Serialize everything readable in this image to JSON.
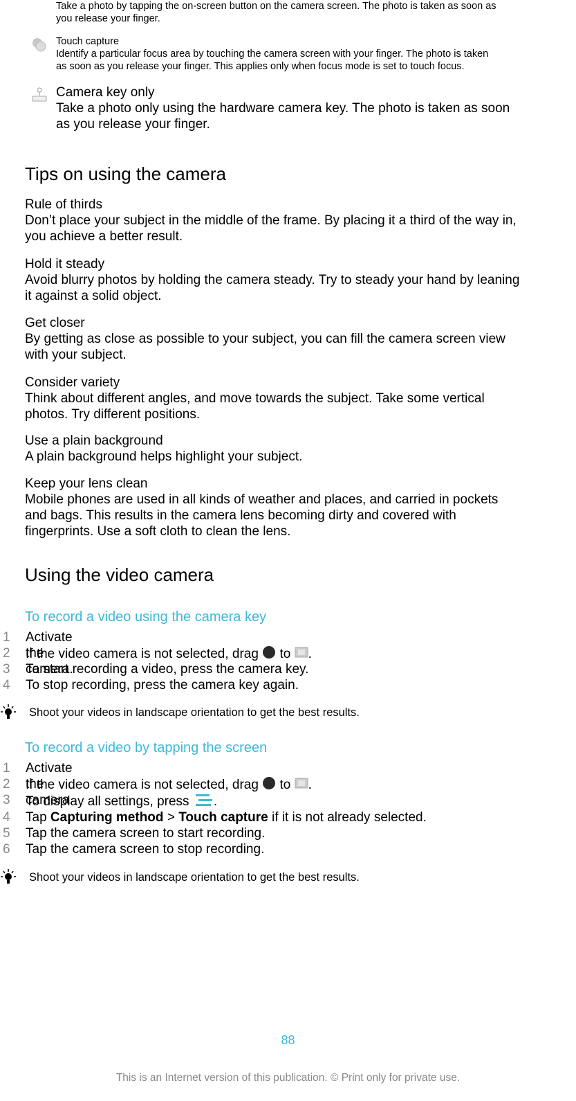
{
  "capture_methods": {
    "onscreen_desc_line1": "Take a photo by tapping the on-screen button on the camera screen. The photo is taken as soon as",
    "onscreen_desc_line2": "you release your finger.",
    "touch_title": "Touch capture",
    "touch_desc_line1": "Identify a particular focus area by touching the camera screen with your finger. The photo is taken",
    "touch_desc_line2": "as soon as you release your finger. This applies only when focus mode is set to touch focus.",
    "key_title": "Camera key only",
    "key_desc_line1": "Take a photo only using the hardware camera key. The photo is taken as soon",
    "key_desc_line2": "as you release your finger."
  },
  "tips": {
    "heading": "Tips on using the camera",
    "items": [
      {
        "title": "Rule of thirds",
        "line1": "Don’t place your subject in the middle of the frame. By placing it a third of the way in,",
        "line2": "you achieve a better result."
      },
      {
        "title": "Hold it steady",
        "line1": "Avoid blurry photos by holding the camera steady. Try to steady your hand by leaning",
        "line2": "it against a solid object."
      },
      {
        "title": "Get closer",
        "line1": "By getting as close as possible to your subject, you can fill the camera screen view",
        "line2": "with your subject."
      },
      {
        "title": "Consider variety",
        "line1": "Think about different angles, and move towards the subject. Take some vertical",
        "line2": "photos. Try different positions."
      },
      {
        "title": "Use a plain background",
        "line1": "A plain background helps highlight your subject."
      },
      {
        "title": "Keep your lens clean",
        "line1": "Mobile phones are used in all kinds of weather and places, and carried in pockets",
        "line2": "and bags. This results in the camera lens becoming dirty and covered with",
        "line3": "fingerprints. Use a soft cloth to clean the lens."
      }
    ]
  },
  "video": {
    "heading": "Using the video camera",
    "proc1": {
      "title": "To record a video using the camera key",
      "steps": [
        {
          "n": "1",
          "text": "Activate the camera."
        },
        {
          "n": "2",
          "pre": "If the video camera is not selected, drag",
          "mid": "to",
          "post": "."
        },
        {
          "n": "3",
          "text": "To start recording a video, press the camera key."
        },
        {
          "n": "4",
          "text": "To stop recording, press the camera key again."
        }
      ],
      "tip": "Shoot your videos in landscape orientation to get the best results."
    },
    "proc2": {
      "title": "To record a video by tapping the screen",
      "steps": [
        {
          "n": "1",
          "text": "Activate the camera."
        },
        {
          "n": "2",
          "pre": "If the video camera is not selected, drag",
          "mid": "to",
          "post": "."
        },
        {
          "n": "3",
          "pre": "To display all settings, press",
          "post": "."
        },
        {
          "n": "4",
          "pre": "Tap",
          "b1": "Capturing method",
          "sep": ">",
          "b2": "Touch capture",
          "post": "if it is not already selected."
        },
        {
          "n": "5",
          "text": "Tap the camera screen to start recording."
        },
        {
          "n": "6",
          "text": "Tap the camera screen to stop recording."
        }
      ],
      "tip": "Shoot your videos in landscape orientation to get the best results."
    }
  },
  "footer": {
    "page_number": "88",
    "note": "This is an Internet version of this publication. © Print only for private use."
  },
  "colors": {
    "accent": "#3db9d9",
    "muted": "#888888"
  }
}
